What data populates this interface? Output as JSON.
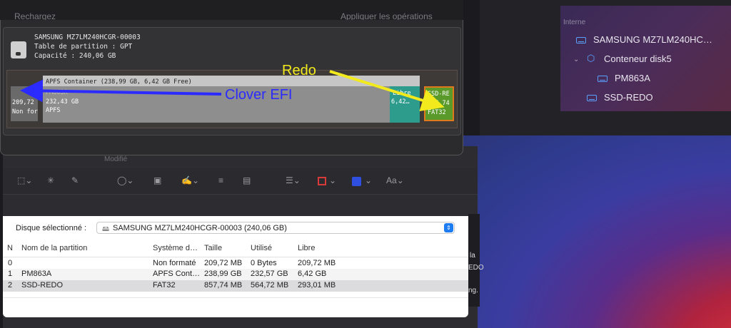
{
  "top_window": {
    "title_left": "Rechargez",
    "title_right": "Appliquer les opérations",
    "disk_name": "SAMSUNG MZ7LM240HCGR-00003",
    "partition_table": "Table de partition : GPT",
    "capacity": "Capacité : 240,06 GB",
    "partitions": {
      "efi": {
        "size": "209,72",
        "fmt": "Non for"
      },
      "container": {
        "title": "APFS Container (238,99 GB, 6,42 GB Free)",
        "name": "PM863A",
        "size": "232,43 GB",
        "fmt": "APFS"
      },
      "libre": {
        "label": "Libre",
        "size": "6,42…"
      },
      "fat": {
        "name": "SSD-RE",
        "size": "857,74",
        "fmt": "FAT32"
      }
    }
  },
  "annotations": {
    "redo": "Redo",
    "clover": "Clover EFI",
    "colors": {
      "redo": "#f2ea1c",
      "clover": "#2b2bff"
    }
  },
  "sidebar": {
    "section": "Interne",
    "items": [
      {
        "label": "SAMSUNG MZ7LM240HC…",
        "icon": "disk-icon"
      },
      {
        "label": "Conteneur disk5",
        "icon": "container-icon"
      },
      {
        "label": "PM863A",
        "icon": "disk-icon"
      },
      {
        "label": "SSD-REDO",
        "icon": "disk-icon"
      }
    ]
  },
  "toolbar": {
    "modify_label": "Modifié",
    "font_label": "Aa"
  },
  "table": {
    "selected_label": "Disque sélectionné :",
    "selected_value": "SAMSUNG MZ7LM240HCGR-00003 (240,06 GB)",
    "headers": [
      "N",
      "Nom de la partition",
      "Système d…",
      "Taille",
      "Utilisé",
      "Libre"
    ],
    "rows": [
      [
        "0",
        "",
        "Non formaté",
        "209,72 MB",
        "0 Bytes",
        "209,72 MB"
      ],
      [
        "1",
        "PM863A",
        "APFS Cont…",
        "238,99 GB",
        "232,57 GB",
        "6,42 GB"
      ],
      [
        "2",
        "SSD-REDO",
        "FAT32",
        "857,74 MB",
        "564,72 MB",
        "293,01 MB"
      ]
    ]
  },
  "snippets": [
    "la",
    "EDO",
    "ng."
  ]
}
